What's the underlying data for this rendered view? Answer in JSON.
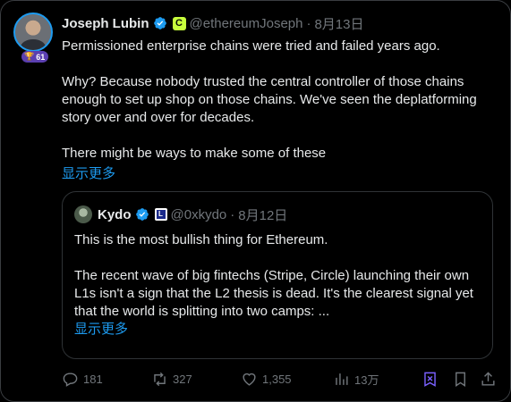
{
  "author": {
    "name": "Joseph Lubin",
    "handle": "@ethereumJoseph",
    "separator": "·",
    "date": "8月13日",
    "level_badge": "61",
    "affiliate_badge_letter": "C",
    "verified_color": "#1d9bf0",
    "affiliate_color": "#c8ff3c",
    "level_badge_color": "#5b3fb1"
  },
  "post": {
    "paragraphs": [
      "Permissioned enterprise chains were tried and failed years ago.",
      "Why?  Because nobody trusted the central controller of those chains enough to set up shop on those chains.  We've seen the deplatforming story over and over for decades.",
      "There might be ways to make some of these"
    ],
    "show_more": "显示更多"
  },
  "quote": {
    "name": "Kydo",
    "handle": "@0xkydo",
    "separator": "·",
    "date": "8月12日",
    "paragraphs": [
      "This is the most bullish thing for Ethereum.",
      "The recent wave of big fintechs (Stripe, Circle) launching their own L1s isn't a sign that the L2 thesis is dead. It's the clearest signal yet that the world is splitting into two camps: ..."
    ],
    "show_more": "显示更多"
  },
  "actions": {
    "replies": "181",
    "reposts": "327",
    "likes": "1,355",
    "views": "13万",
    "icons": [
      "reply-icon",
      "repost-icon",
      "like-icon",
      "views-icon",
      "grok-icon",
      "bookmark-icon",
      "share-icon"
    ]
  },
  "colors": {
    "background": "#000000",
    "text": "#e7e9ea",
    "muted": "#71767b",
    "link": "#1d9bf0",
    "border": "#2f3336"
  }
}
